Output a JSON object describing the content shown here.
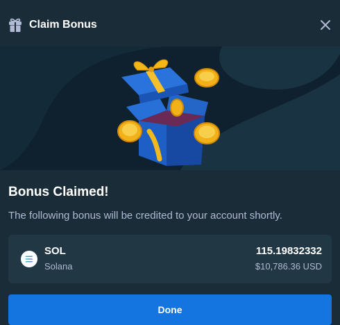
{
  "header": {
    "title": "Claim Bonus",
    "gift_icon": "gift-icon",
    "close_icon": "close-icon"
  },
  "banner": {
    "illustration": "open-gift-box-with-gold-coins"
  },
  "content": {
    "title": "Bonus Claimed!",
    "description": "The following bonus will be credited to your account shortly."
  },
  "currency": {
    "symbol": "SOL",
    "name": "Solana",
    "amount": "115.19832332",
    "usd_value": "$10,786.36 USD",
    "icon": "solana-icon"
  },
  "actions": {
    "done_label": "Done"
  },
  "colors": {
    "background": "#1a2c38",
    "banner": "#0f212e",
    "card": "#213743",
    "muted_text": "#b1bad3",
    "primary_button": "#1475e1"
  }
}
